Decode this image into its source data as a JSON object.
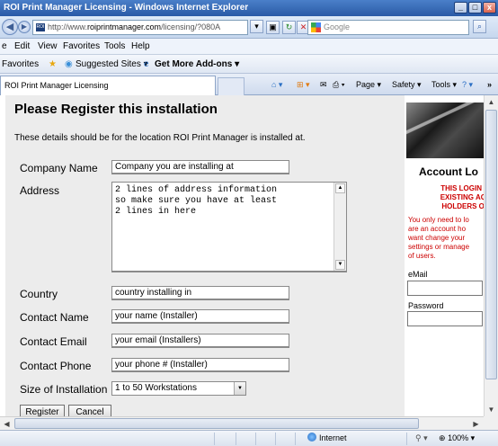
{
  "window": {
    "title": "ROI Print Manager Licensing - Windows Internet Explorer",
    "min": "_",
    "max": "□",
    "close": "x"
  },
  "address": {
    "url_prefix": "http://www.",
    "url_site": "roiprintmanager.com",
    "url_path": "/licensing/?080A",
    "search_placeholder": "Google"
  },
  "menu": {
    "file": "e",
    "edit": "Edit",
    "view": "View",
    "favorites": "Favorites",
    "tools": "Tools",
    "help": "Help"
  },
  "favbar": {
    "favorites": "Favorites",
    "suggested": "Suggested Sites ▾",
    "addons": "Get More Add-ons ▾"
  },
  "tab": {
    "title": "ROI Print Manager Licensing"
  },
  "commands": {
    "page": "Page ▾",
    "safety": "Safety ▾",
    "tools": "Tools ▾",
    "more": "»"
  },
  "form": {
    "title": "Please Register this installation",
    "subtitle": "These details should be for the location ROI Print Manager is installed at.",
    "company_label": "Company Name",
    "company_value": "Company you are installing at",
    "address_label": "Address",
    "address_value": "2 lines of address information\nso make sure you have at least\n2 lines in here",
    "country_label": "Country",
    "country_value": "country installing in",
    "contact_name_label": "Contact Name",
    "contact_name_value": "your name (Installer)",
    "contact_email_label": "Contact Email",
    "contact_email_value": "your email  (Installers)",
    "contact_phone_label": "Contact Phone",
    "contact_phone_value": "your phone # (Installer)",
    "size_label": "Size of Installation",
    "size_value": "1 to 50 Workstations",
    "register_button": "Register",
    "cancel_button": "Cancel"
  },
  "side": {
    "account_title": "Account Lo",
    "login_note": "THIS LOGIN IS\nEXISTING ACC\nHOLDERS ON",
    "info": "You only need to lo\nare an account ho\nwant change your\nsettings or manage\nof users.",
    "email_label": "eMail",
    "password_label": "Password"
  },
  "status": {
    "zone": "Internet",
    "zoom": "100%"
  }
}
